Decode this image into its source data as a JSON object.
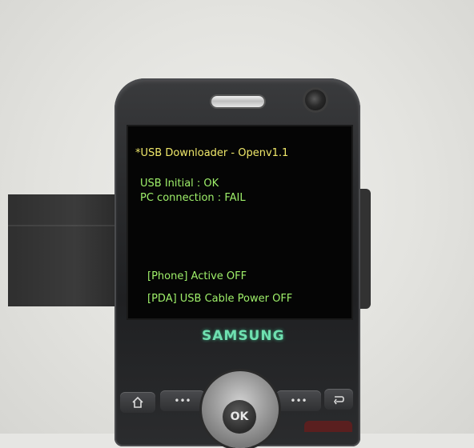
{
  "screen": {
    "title": "*USB Downloader - Openv1.1",
    "usb_initial": "USB Initial : OK",
    "pc_connection": "PC connection : FAIL",
    "phone_status": "[Phone] Active OFF",
    "pda_status": "[PDA] USB Cable Power OFF"
  },
  "device": {
    "brand": "SAMSUNG",
    "ok_label": "OK",
    "left_soft_label": "•••",
    "right_soft_label": "•••"
  },
  "colors": {
    "title_text": "#f0e86a",
    "body_text": "#9ff06a",
    "brand_text": "#6fe0b0",
    "screen_bg": "#050505"
  },
  "icons": {
    "home": "home-icon",
    "back": "back-arrow-icon"
  }
}
